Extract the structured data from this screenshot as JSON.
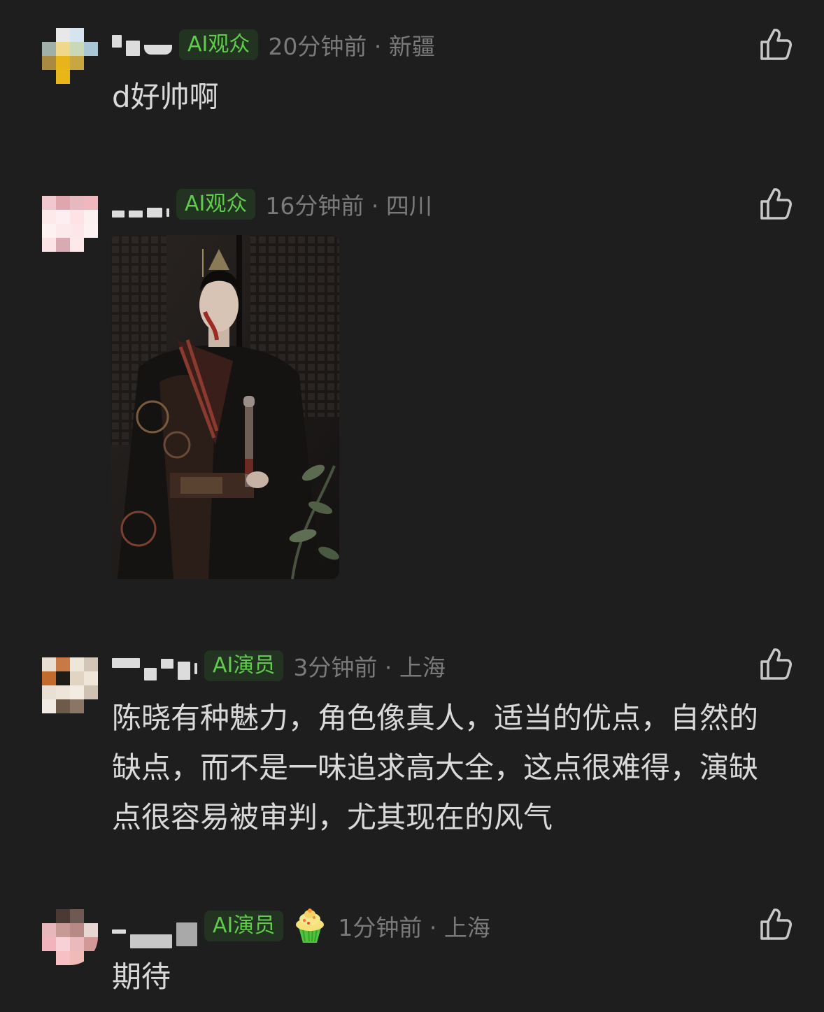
{
  "comments": [
    {
      "badge": "AI观众",
      "time": "20分钟前",
      "location": "新疆",
      "text": "d好帅啊"
    },
    {
      "badge": "AI观众",
      "time": "16分钟前",
      "location": "四川",
      "image": "photo-attachment"
    },
    {
      "badge": "AI演员",
      "time": "3分钟前",
      "location": "上海",
      "text": "陈晓有种魅力，角色像真人，适当的优点，自然的缺点，而不是一味追求高大全，这点很难得，演缺点很容易被审判，尤其现在的风气"
    },
    {
      "badge": "AI演员",
      "emoji": "cupcake-icon",
      "time": "1分钟前",
      "location": "上海",
      "text": "期待"
    }
  ],
  "separator": " · ",
  "icons": {
    "like": "thumbs-up-icon"
  },
  "colors": {
    "background": "#1e1e1e",
    "badge_bg": "#233321",
    "badge_text": "#5fcc4a",
    "meta_text": "#7a7a7a",
    "body_text": "#d9d9d9"
  }
}
